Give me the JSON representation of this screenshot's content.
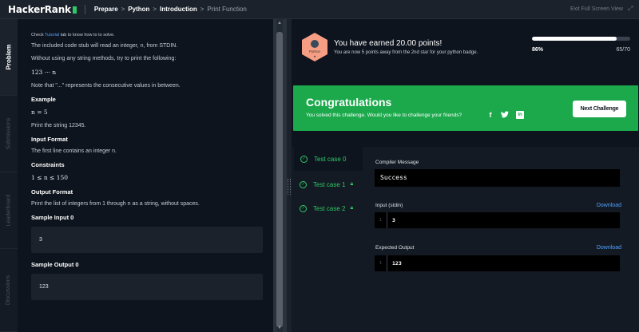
{
  "topbar": {
    "logo": "HackerRank",
    "breadcrumbs": [
      "Prepare",
      "Python",
      "Introduction",
      "Print Function"
    ],
    "exit_label": "Exit Full Screen View"
  },
  "sidetabs": [
    "Problem",
    "Submissions",
    "Leaderboard",
    "Discussions"
  ],
  "problem": {
    "tutorial_prefix": "Check ",
    "tutorial_link": "Tutorial",
    "tutorial_suffix": " tab to know how to to solve.",
    "intro": "The included code stub will read an integer, n, from STDIN.",
    "instruction": "Without using any string methods, try to print the following:",
    "sequence": "123 ··· n",
    "note": "Note that \"...\" represents the consecutive values in between.",
    "example_heading": "Example",
    "example_n": "n = 5",
    "example_print": "Print the string 12345.",
    "input_format_heading": "Input Format",
    "input_format": "The first line contains an integer n.",
    "constraints_heading": "Constraints",
    "constraints": "1 ≤ n ≤ 150",
    "output_format_heading": "Output Format",
    "output_format": "Print the list of integers from 1 through n as a string, without spaces.",
    "sample_input_heading": "Sample Input 0",
    "sample_input": "3",
    "sample_output_heading": "Sample Output 0",
    "sample_output": "123"
  },
  "achievement": {
    "badge_label": "Python",
    "badge_stars": "★",
    "title": "You have earned 20.00 points!",
    "subtitle": "You are now 5 points away from the 2nd star for your python badge.",
    "progress_fraction": 0.86,
    "percent": "86%",
    "points": "65/70"
  },
  "congrats": {
    "title": "Congratulations",
    "subtitle": "You solved this challenge. Would you like to challenge your friends?",
    "facebook_glyph": "f",
    "twitter_glyph": "🐦",
    "linkedin_glyph": "in",
    "next_button": "Next Challenge"
  },
  "testcases": [
    {
      "label": "Test case 0",
      "locked": false
    },
    {
      "label": "Test case 1",
      "locked": true
    },
    {
      "label": "Test case 2",
      "locked": true
    }
  ],
  "results": {
    "compiler_label": "Compiler Message",
    "compiler_message": "Success",
    "input_label": "Input (stdin)",
    "input_line_no": "1",
    "input_value": "3",
    "expected_label": "Expected Output",
    "expected_line_no": "1",
    "expected_value": "123",
    "download_label": "Download"
  },
  "colors": {
    "accent": "#2ec866",
    "banner": "#1ba94c",
    "link": "#4ea1ff",
    "badge": "#f59e83"
  }
}
